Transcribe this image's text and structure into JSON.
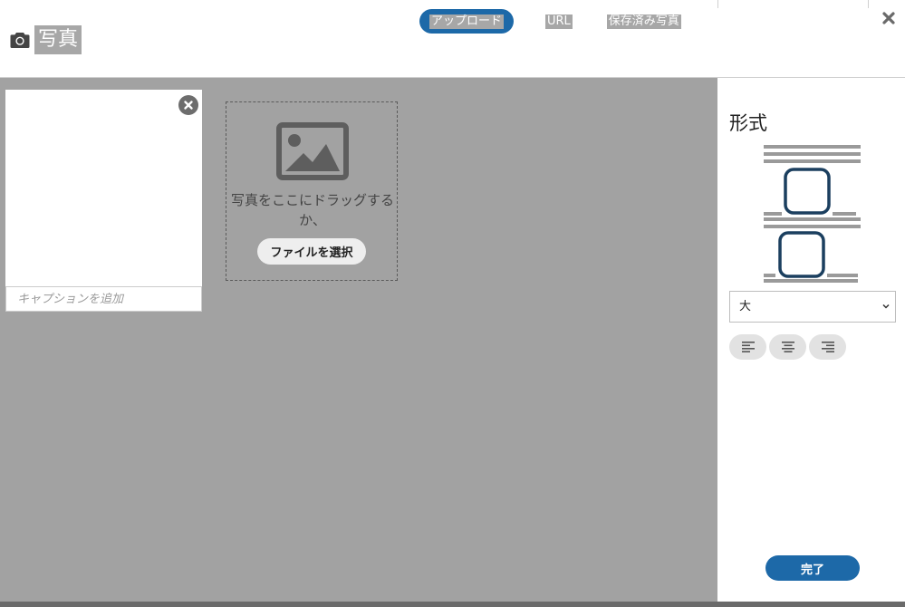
{
  "header": {
    "title": "写真",
    "tabs": [
      {
        "label": "アップロード",
        "active": true
      },
      {
        "label": "URL",
        "active": false
      },
      {
        "label": "保存済み写真",
        "active": false
      }
    ],
    "icons": {
      "title": "camera-icon",
      "close": "close-icon"
    }
  },
  "upload": {
    "caption_placeholder": "キャプションを追加",
    "drop_text": "写真をここにドラッグするか、",
    "choose_file_label": "ファイルを選択",
    "icons": {
      "placeholder": "image-icon",
      "remove": "remove-circle-icon"
    }
  },
  "panel": {
    "title": "形式",
    "size_selected": "大",
    "align_buttons": [
      "align-left-icon",
      "align-center-icon",
      "align-right-icon"
    ],
    "done_label": "完了"
  },
  "colors": {
    "accent": "#1d69a8",
    "overlay": "#a2a2a2",
    "illustration": "#1b3f5f"
  }
}
